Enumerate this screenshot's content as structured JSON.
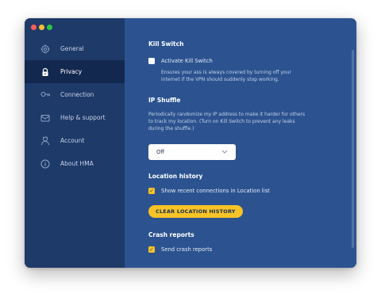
{
  "sidebar": {
    "items": [
      {
        "label": "General",
        "icon": "gear-icon"
      },
      {
        "label": "Privacy",
        "icon": "lock-icon"
      },
      {
        "label": "Connection",
        "icon": "key-icon"
      },
      {
        "label": "Help & support",
        "icon": "envelope-icon"
      },
      {
        "label": "Account",
        "icon": "user-icon"
      },
      {
        "label": "About HMA",
        "icon": "info-icon"
      }
    ],
    "active": "Privacy"
  },
  "kill_switch": {
    "title": "Kill Switch",
    "checkbox_label": "Activate Kill Switch",
    "checked": false,
    "description_line1": "Ensures your ass is always covered by turning off your",
    "description_line2": "internet if the VPN should suddenly stop working."
  },
  "ip_shuffle": {
    "title": "IP Shuffle",
    "description_line1": "Periodically randomize my IP address to make it harder for others",
    "description_line2": "to track my location. (Turn on Kill Switch to prevent any leaks",
    "description_line3": "during the shuffle.)",
    "selected": "Off"
  },
  "location_history": {
    "title": "Location history",
    "checkbox_label": "Show recent connections in Location list",
    "checked": true,
    "clear_button": "CLEAR LOCATION HISTORY"
  },
  "crash_reports": {
    "title": "Crash reports",
    "checkbox_label": "Send crash reports",
    "checked": true
  },
  "colors": {
    "main_bg": "#2c5390",
    "sidebar_bg": "#1e3a69",
    "active_bg": "#13284f",
    "accent": "#f7c325"
  }
}
